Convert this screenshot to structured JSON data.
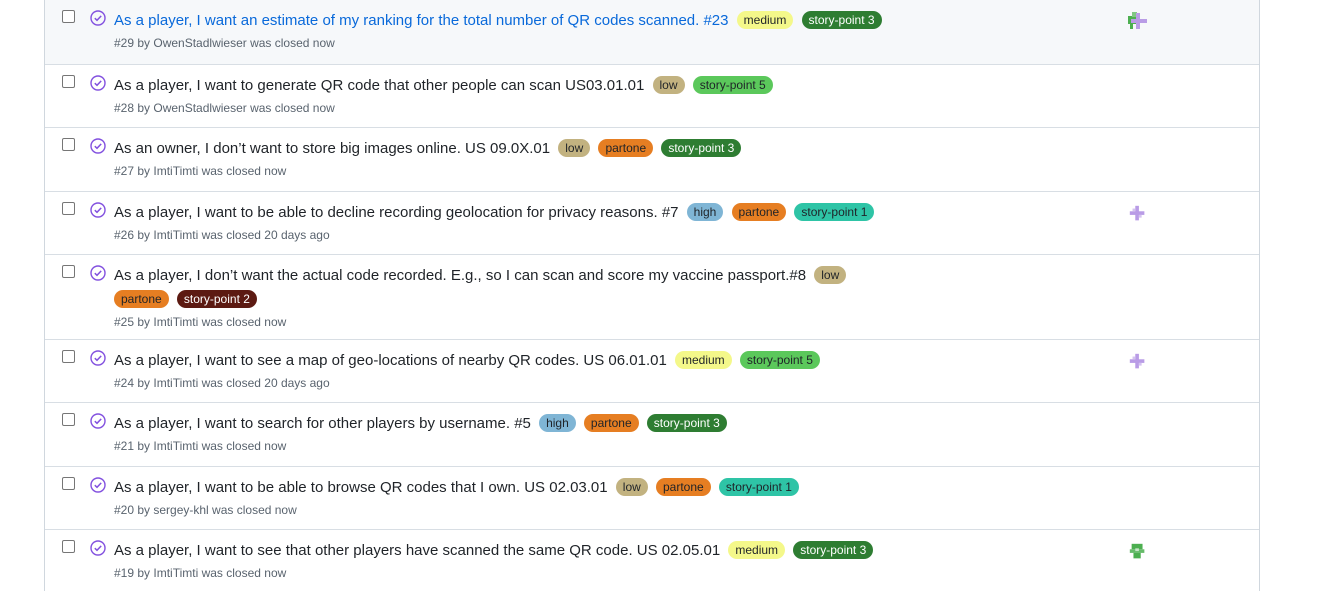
{
  "issues": [
    {
      "title": "As a player, I want an estimate of my ranking for the total number of QR codes scanned. #23",
      "labels": [
        {
          "text": "medium",
          "cls": "medium"
        },
        {
          "text": "story-point 3",
          "cls": "sp3"
        }
      ],
      "meta": "#29 by OwenStadlwieser was closed now",
      "avatar": "mixed"
    },
    {
      "title": "As a player, I want to generate QR code that other people can scan US03.01.01",
      "labels": [
        {
          "text": "low",
          "cls": "low"
        },
        {
          "text": "story-point 5",
          "cls": "sp5"
        }
      ],
      "meta": "#28 by OwenStadlwieser was closed now",
      "avatar": ""
    },
    {
      "title": "As an owner, I don’t want to store big images online. US 09.0X.01",
      "labels": [
        {
          "text": "low",
          "cls": "low"
        },
        {
          "text": "partone",
          "cls": "partone"
        },
        {
          "text": "story-point 3",
          "cls": "sp3"
        }
      ],
      "meta": "#27 by ImtiTimti was closed now",
      "avatar": ""
    },
    {
      "title": "As a player, I want to be able to decline recording geolocation for privacy reasons. #7",
      "labels": [
        {
          "text": "high",
          "cls": "high"
        },
        {
          "text": "partone",
          "cls": "partone"
        },
        {
          "text": "story-point 1",
          "cls": "sp1"
        }
      ],
      "meta": "#26 by ImtiTimti was closed 20 days ago",
      "avatar": "purple"
    },
    {
      "title": "As a player, I don’t want the actual code recorded. E.g., so I can scan and score my vaccine passport.#8",
      "labels": [
        {
          "text": "low",
          "cls": "low"
        },
        {
          "text": "partone",
          "cls": "partone"
        },
        {
          "text": "story-point 2",
          "cls": "sp2"
        }
      ],
      "meta": "#25 by ImtiTimti was closed now",
      "avatar": ""
    },
    {
      "title": "As a player, I want to see a map of geo-locations of nearby QR codes. US 06.01.01",
      "labels": [
        {
          "text": "medium",
          "cls": "medium"
        },
        {
          "text": "story-point 5",
          "cls": "sp5"
        }
      ],
      "meta": "#24 by ImtiTimti was closed 20 days ago",
      "avatar": "purple"
    },
    {
      "title": "As a player, I want to search for other players by username. #5",
      "labels": [
        {
          "text": "high",
          "cls": "high"
        },
        {
          "text": "partone",
          "cls": "partone"
        },
        {
          "text": "story-point 3",
          "cls": "sp3"
        }
      ],
      "meta": "#21 by ImtiTimti was closed now",
      "avatar": ""
    },
    {
      "title": "As a player, I want to be able to browse QR codes that I own. US 02.03.01",
      "labels": [
        {
          "text": "low",
          "cls": "low"
        },
        {
          "text": "partone",
          "cls": "partone"
        },
        {
          "text": "story-point 1",
          "cls": "sp1"
        }
      ],
      "meta": "#20 by sergey-khl was closed now",
      "avatar": ""
    },
    {
      "title": "As a player, I want to see that other players have scanned the same QR code. US 02.05.01",
      "labels": [
        {
          "text": "medium",
          "cls": "medium"
        },
        {
          "text": "story-point 3",
          "cls": "sp3"
        }
      ],
      "meta": "#19 by ImtiTimti was closed now",
      "avatar": "green"
    }
  ],
  "colors": {
    "closed_icon": "#8250df",
    "link": "#0969da",
    "avatar_purple": "#b99ce6",
    "avatar_green": "#4caf50"
  }
}
